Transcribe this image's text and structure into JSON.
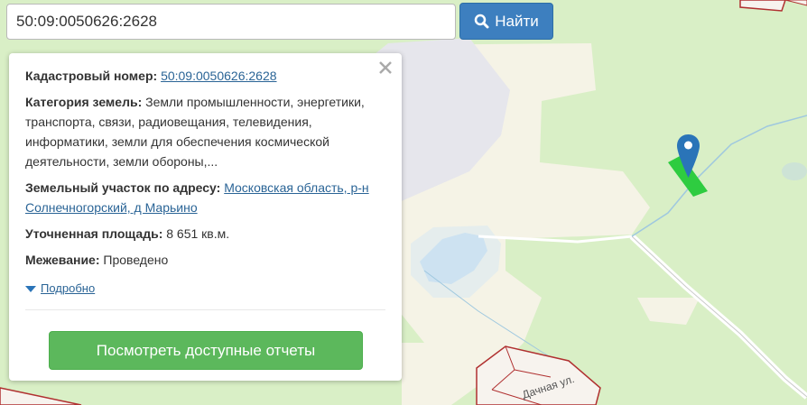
{
  "search": {
    "value": "50:09:0050626:2628",
    "button_label": "Найти"
  },
  "panel": {
    "cadastral_label": "Кадастровый номер:",
    "cadastral_value": "50:09:0050626:2628",
    "category_label": "Категория земель:",
    "category_value": "Земли промышленности, энергетики, транспорта, связи, радиовещания, телевидения, информатики, земли для обеспечения космической деятельности, земли обороны,...",
    "address_label": "Земельный участок по адресу:",
    "address_value": "Московская область, р-н Солнечногорский, д Марьино",
    "area_label": "Уточненная площадь:",
    "area_value": "8 651 кв.м.",
    "survey_label": "Межевание:",
    "survey_value": "Проведено",
    "more_label": "Подробно",
    "report_button": "Посмотреть доступные отчеты"
  },
  "map": {
    "street_label": "Дачная ул."
  },
  "colors": {
    "accent_blue": "#3d7fbf",
    "accent_green": "#5cb85c",
    "parcel_border": "#b03030",
    "highlight": "#2ecc40",
    "marker": "#2a74b8"
  }
}
